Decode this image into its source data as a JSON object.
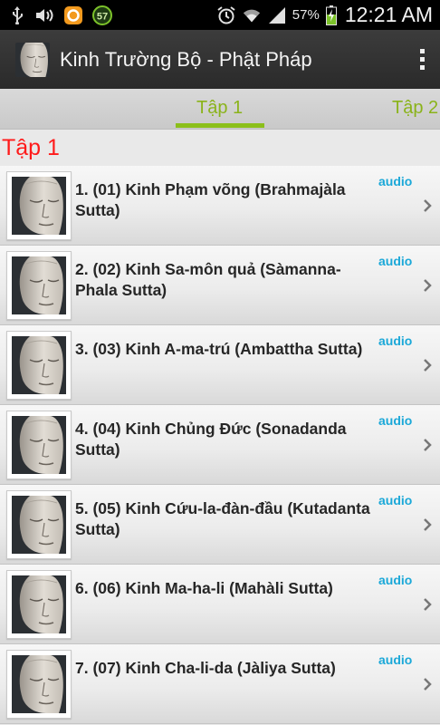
{
  "status_bar": {
    "notification_badge": "57",
    "battery_percent": "57%",
    "time": "12:21 AM",
    "icons": [
      "usb-icon",
      "volume-icon",
      "app-notification-icon",
      "badge-57-icon",
      "alarm-icon",
      "wifi-icon",
      "signal-icon",
      "battery-charging-icon"
    ]
  },
  "action_bar": {
    "title": "Kinh Trường Bộ - Phật Pháp",
    "icon": "buddha-face-icon",
    "overflow": "more-vert-icon"
  },
  "tabs": [
    {
      "label": "Tập 1",
      "selected": true
    },
    {
      "label": "Tập 2",
      "selected": false
    }
  ],
  "colors": {
    "tab_text": "#8ab31a",
    "tab_indicator": "#8bbf1a",
    "section_title": "#ff1a1a",
    "audio_tag": "#1ba8d8"
  },
  "section_title": "Tập 1",
  "items": [
    {
      "title": "1. (01) Kinh Phạm võng (Brahmajàla Sutta)",
      "tag": "audio"
    },
    {
      "title": "2. (02) Kinh Sa-môn quả (Sàmanna-Phala Sutta)",
      "tag": "audio"
    },
    {
      "title": "3. (03) Kinh A-ma-trú (Ambattha Sutta)",
      "tag": "audio"
    },
    {
      "title": "4. (04) Kinh Chủng Đức (Sonadanda Sutta)",
      "tag": "audio"
    },
    {
      "title": "5. (05) Kinh Cứu-la-đàn-đầu (Kutadanta Sutta)",
      "tag": "audio"
    },
    {
      "title": "6. (06) Kinh Ma-ha-li (Mahàli Sutta)",
      "tag": "audio"
    },
    {
      "title": "7. (07) Kinh Cha-li-da (Jàliya Sutta)",
      "tag": "audio"
    }
  ]
}
